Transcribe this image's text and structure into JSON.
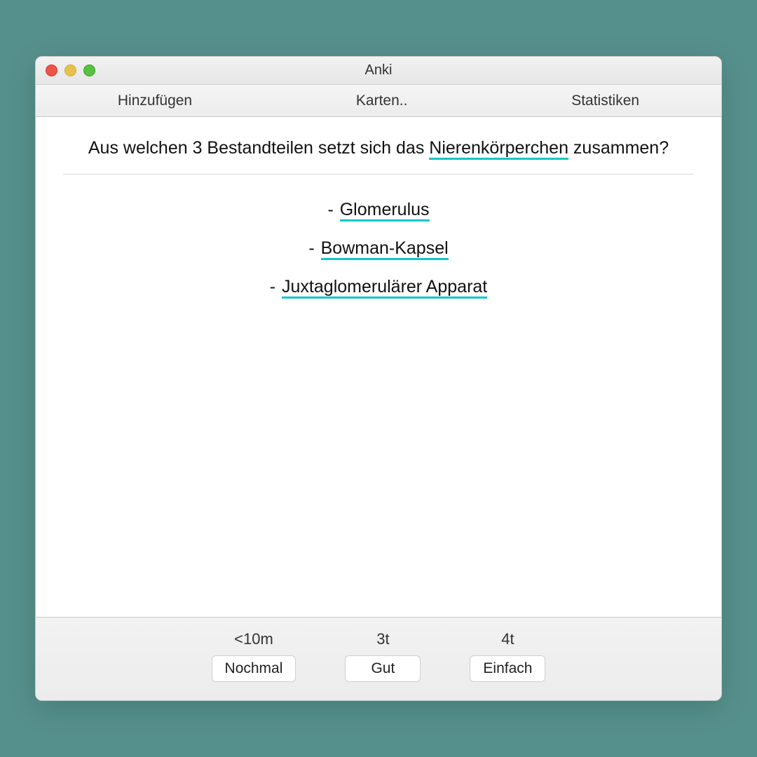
{
  "window": {
    "title": "Anki"
  },
  "toolbar": {
    "add": "Hinzufügen",
    "cards": "Karten..",
    "stats": "Statistiken"
  },
  "question": {
    "pre": "Aus welchen 3 Bestandteilen setzt sich das ",
    "term": "Nierenkörperchen",
    "post": " zusammen?"
  },
  "answers": [
    "Glomerulus",
    "Bowman-Kapsel",
    "Juxtaglomerulärer Apparat"
  ],
  "ratings": {
    "again": {
      "interval": "<10m",
      "label": "Nochmal"
    },
    "good": {
      "interval": "3t",
      "label": "Gut"
    },
    "easy": {
      "interval": "4t",
      "label": "Einfach"
    }
  }
}
